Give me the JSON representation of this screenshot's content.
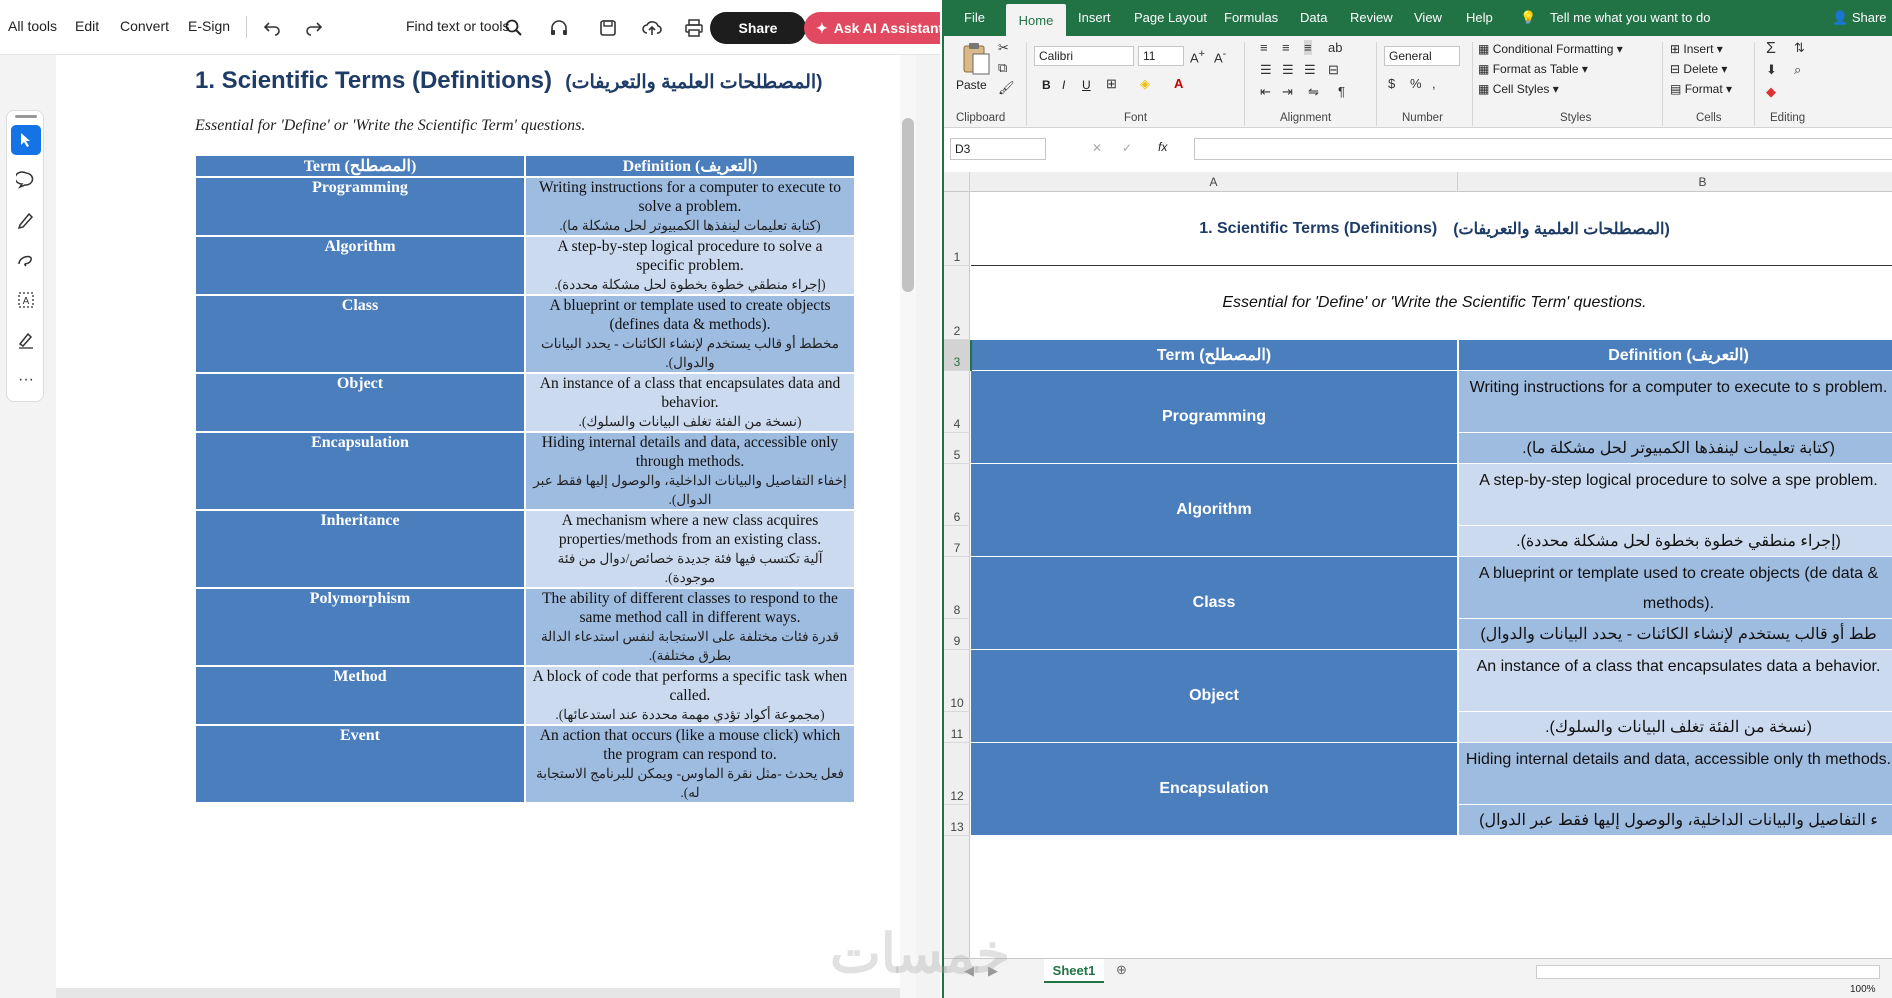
{
  "acrobat": {
    "menu": [
      "All tools",
      "Edit",
      "Convert",
      "E-Sign"
    ],
    "find_label": "Find text or tools",
    "share_label": "Share",
    "ai_label": "Ask AI Assistant",
    "doc_title": "1. Scientific Terms (Definitions)",
    "doc_title_ar": "(المصطلحات العلمية والتعريفات)",
    "doc_subtitle": "Essential for 'Define' or 'Write the Scientific Term' questions.",
    "table_headers": [
      "Term (المصطلح)",
      "Definition (التعريف)"
    ],
    "rows": [
      {
        "term": "Programming",
        "def": "Writing instructions for a computer to execute to solve a problem.",
        "ar": "(كتابة تعليمات لينفذها الكمبيوتر لحل مشكلة ما)."
      },
      {
        "term": "Algorithm",
        "def": "A step-by-step logical procedure to solve a specific problem.",
        "ar": "(إجراء منطقي خطوة بخطوة لحل مشكلة محددة)."
      },
      {
        "term": "Class",
        "def": "A blueprint or template used to create objects (defines data & methods).",
        "ar": "مخطط أو قالب يستخدم لإنشاء الكائنات - يحدد البيانات والدوال)."
      },
      {
        "term": "Object",
        "def": "An instance of a class that encapsulates data and behavior.",
        "ar": "(نسخة من الفئة تغلف البيانات والسلوك)."
      },
      {
        "term": "Encapsulation",
        "def": "Hiding internal details and data, accessible only through methods.",
        "ar": "إخفاء التفاصيل والبيانات الداخلية، والوصول إليها فقط عبر الدوال)."
      },
      {
        "term": "Inheritance",
        "def": "A mechanism where a new class acquires properties/methods from an existing class.",
        "ar": "آلية تكتسب فيها فئة جديدة خصائص/دوال من فئة موجودة)."
      },
      {
        "term": "Polymorphism",
        "def": "The ability of different classes to respond to the same method call in different ways.",
        "ar": "قدرة فئات مختلفة على الاستجابة لنفس استدعاء الدالة بطرق مختلفة)."
      },
      {
        "term": "Method",
        "def": "A block of code that performs a specific task when called.",
        "ar": "(مجموعة أكواد تؤدي مهمة محددة عند استدعائها)."
      },
      {
        "term": "Event",
        "def": "An action that occurs (like a mouse click) which the program can respond to.",
        "ar": "فعل يحدث -مثل نقرة الماوس- ويمكن للبرنامج الاستجابة له)."
      }
    ]
  },
  "excel": {
    "tabs": [
      "File",
      "Home",
      "Insert",
      "Page Layout",
      "Formulas",
      "Data",
      "Review",
      "View",
      "Help"
    ],
    "tell_me": "Tell me what you want to do",
    "share_label": "Share",
    "ribbon": {
      "paste": "Paste",
      "clipboard": "Clipboard",
      "font_name": "Calibri",
      "font_size": "11",
      "font": "Font",
      "alignment": "Alignment",
      "number_format": "General",
      "number": "Number",
      "cond_format": "Conditional Formatting",
      "format_table": "Format as Table",
      "cell_styles": "Cell Styles",
      "styles": "Styles",
      "insert": "Insert",
      "delete": "Delete",
      "format": "Format",
      "cells": "Cells",
      "editing": "Editing",
      "bold": "B",
      "italic": "I",
      "underline": "U"
    },
    "name_box": "D3",
    "fx": "fx",
    "columns": [
      "A",
      "B"
    ],
    "title": "1. Scientific Terms (Definitions)",
    "title_ar": "(المصطلحات العلمية والتعريفات)",
    "subtitle": "Essential for 'Define' or 'Write the Scientific Term' questions.",
    "headers": [
      "Term (المصطلح)",
      "Definition (التعريف)"
    ],
    "row_numbers": [
      "1",
      "2",
      "3",
      "4",
      "5",
      "6",
      "7",
      "8",
      "9",
      "10",
      "11",
      "12",
      "13"
    ],
    "cells": [
      {
        "term": "Programming",
        "en": "Writing instructions for a computer to execute to s problem.",
        "ar": "(كتابة تعليمات لينفذها الكمبيوتر لحل مشكلة ما)."
      },
      {
        "term": "Algorithm",
        "en": "A step-by-step logical procedure to solve a spe problem.",
        "ar": "(إجراء منطقي خطوة بخطوة لحل مشكلة محددة)."
      },
      {
        "term": "Class",
        "en": "A blueprint or template used to create objects (de data & methods).",
        "ar": "طط أو قالب يستخدم لإنشاء الكائنات - يحدد البيانات والدوال)"
      },
      {
        "term": "Object",
        "en": "An instance of a class that encapsulates data a behavior.",
        "ar": "(نسخة من الفئة تغلف البيانات والسلوك)."
      },
      {
        "term": "Encapsulation",
        "en": "Hiding internal details and data, accessible only th methods.",
        "ar": "ء التفاصيل والبيانات الداخلية، والوصول إليها فقط عبر الدوال)"
      }
    ],
    "sheet_tab": "Sheet1",
    "zoom": "100%"
  },
  "watermark": "خمسات"
}
